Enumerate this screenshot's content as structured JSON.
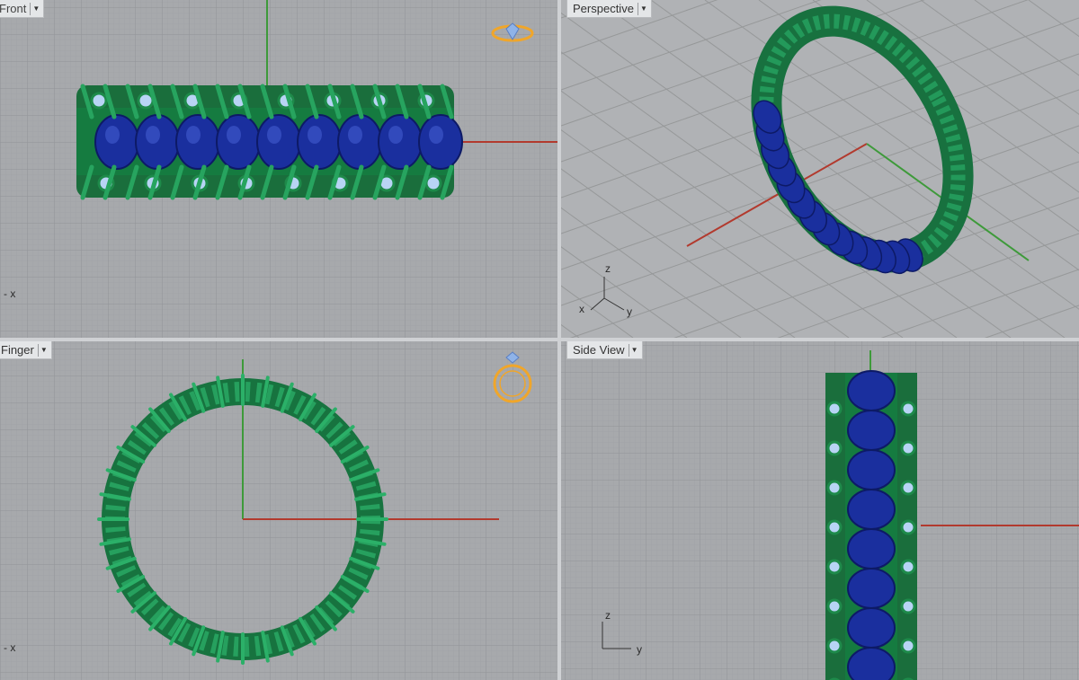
{
  "viewports": {
    "top": {
      "title": "Front"
    },
    "perspective": {
      "title": "Perspective"
    },
    "finger": {
      "title": "Finger"
    },
    "side": {
      "title": "Side View"
    }
  },
  "axes": {
    "x": "x",
    "y": "y",
    "z": "z"
  },
  "colors": {
    "background": "#a7a9ac",
    "grid": "#8e9093",
    "x_axis": "#b23a2e",
    "y_axis": "#3e9a3a",
    "metal": "#1e8a4a",
    "sapphire": "#1a2f9e",
    "diamond": "#b8d4f5",
    "icon_gold": "#f0a62a"
  },
  "icons": [
    "ring-preview-icon",
    "ring-front-icon",
    "dropdown-arrow-icon"
  ]
}
